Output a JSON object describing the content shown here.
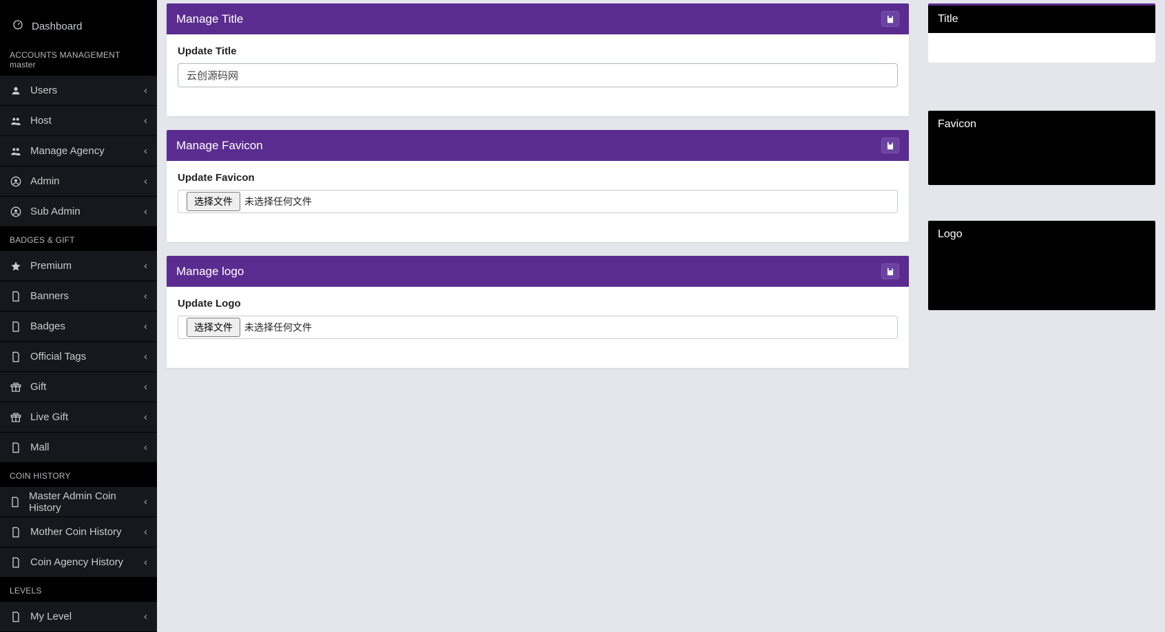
{
  "sidebar": {
    "dashboard": "Dashboard",
    "section_accounts": "ACCOUNTS MANAGEMENT master",
    "section_badges": "BADGES & GIFT",
    "section_coin": "COIN HISTORY",
    "section_levels": "LEVELS",
    "items_accounts": [
      {
        "label": "Users",
        "icon": "user"
      },
      {
        "label": "Host",
        "icon": "users"
      },
      {
        "label": "Manage Agency",
        "icon": "users"
      },
      {
        "label": "Admin",
        "icon": "circle-user"
      },
      {
        "label": "Sub Admin",
        "icon": "circle-user"
      }
    ],
    "items_badges": [
      {
        "label": "Premium",
        "icon": "star"
      },
      {
        "label": "Banners",
        "icon": "doc"
      },
      {
        "label": "Badges",
        "icon": "doc"
      },
      {
        "label": "Official Tags",
        "icon": "doc"
      },
      {
        "label": "Gift",
        "icon": "gift"
      },
      {
        "label": "Live Gift",
        "icon": "gift"
      },
      {
        "label": "Mall",
        "icon": "doc"
      }
    ],
    "items_coin": [
      {
        "label": "Master Admin Coin History",
        "icon": "doc"
      },
      {
        "label": "Mother Coin History",
        "icon": "doc"
      },
      {
        "label": "Coin Agency History",
        "icon": "doc"
      }
    ],
    "items_levels": [
      {
        "label": "My Level",
        "icon": "doc"
      }
    ]
  },
  "panels": {
    "title": {
      "header": "Manage Title",
      "label": "Update Title",
      "value": "云创源码网"
    },
    "favicon": {
      "header": "Manage Favicon",
      "label": "Update Favicon",
      "file_button": "选择文件",
      "file_status": "未选择任何文件"
    },
    "logo": {
      "header": "Manage logo",
      "label": "Update Logo",
      "file_button": "选择文件",
      "file_status": "未选择任何文件"
    }
  },
  "previews": {
    "title": "Title",
    "favicon": "Favicon",
    "logo": "Logo"
  }
}
